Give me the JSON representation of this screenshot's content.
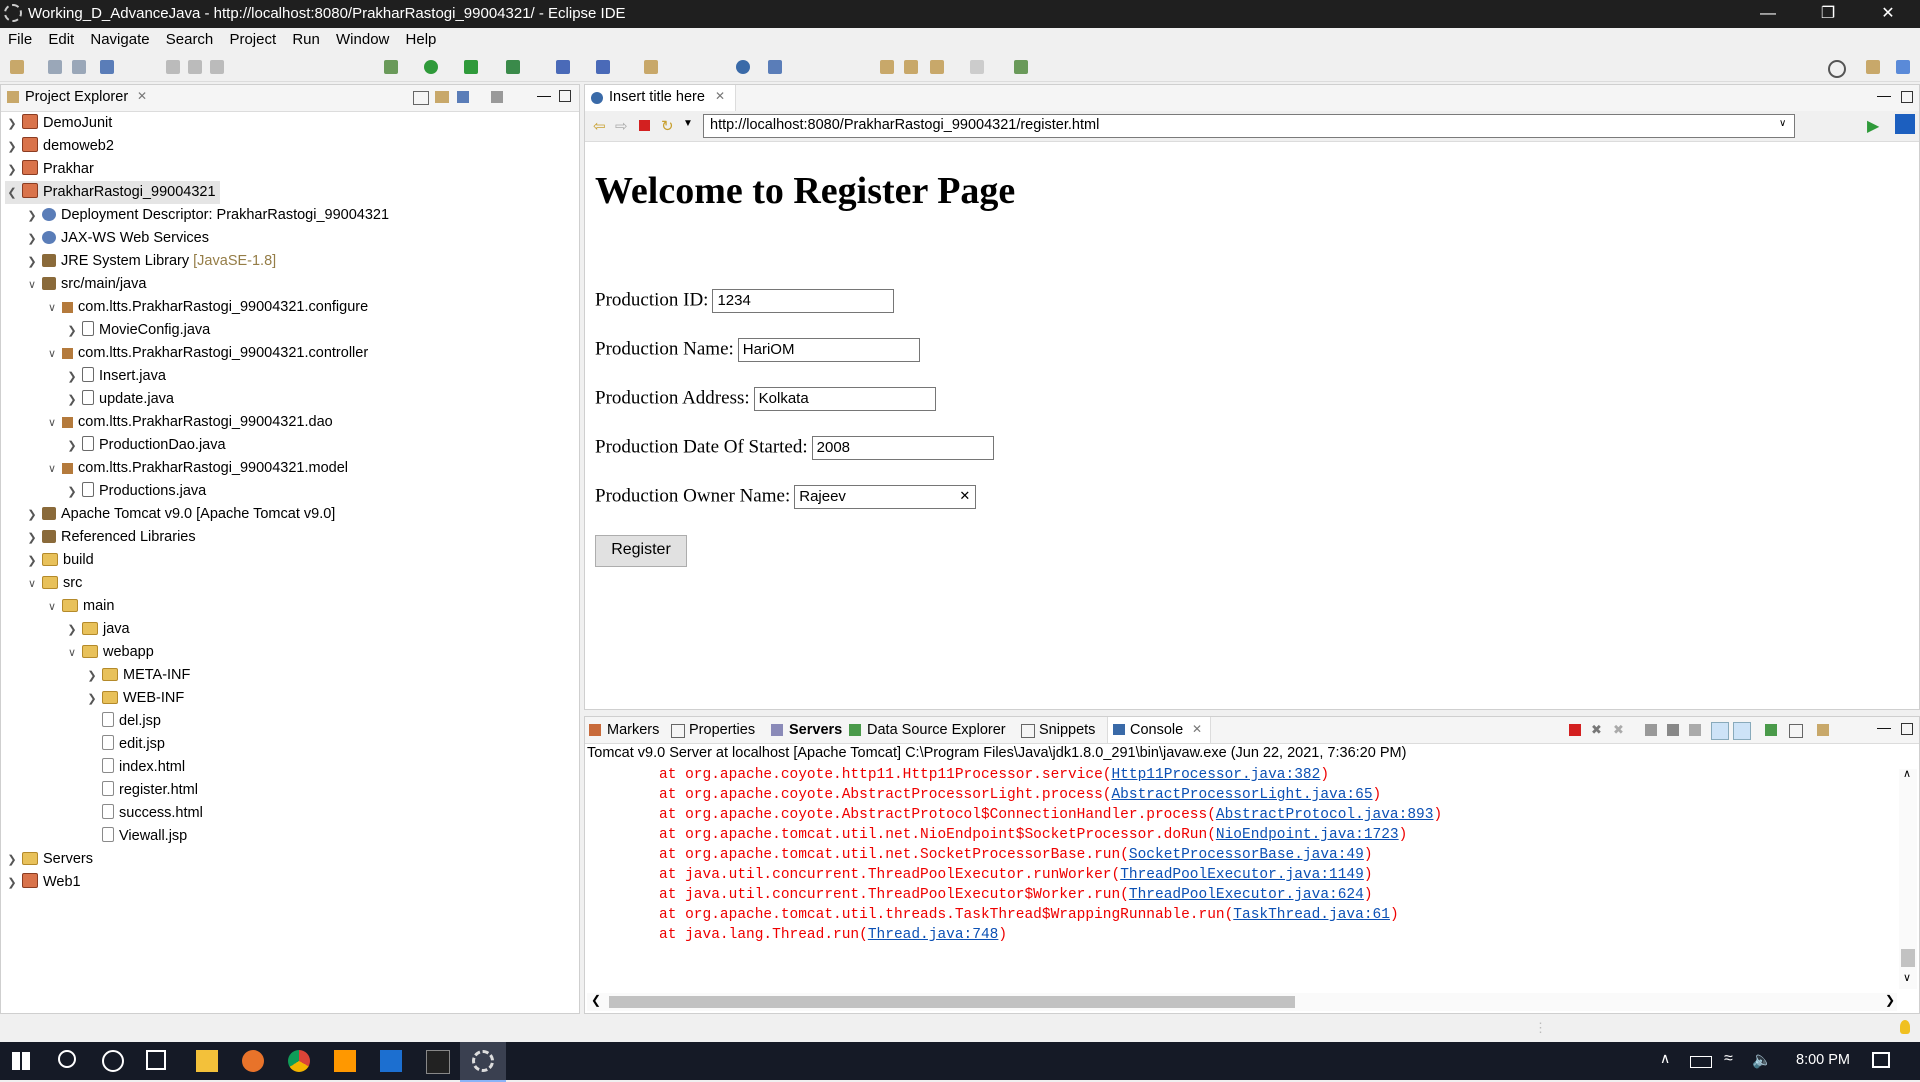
{
  "window": {
    "title": "Working_D_AdvanceJava - http://localhost:8080/PrakharRastogi_99004321/ - Eclipse IDE"
  },
  "menu": [
    "File",
    "Edit",
    "Navigate",
    "Search",
    "Project",
    "Run",
    "Window",
    "Help"
  ],
  "explorer": {
    "title": "Project Explorer",
    "items": [
      {
        "label": "DemoJunit",
        "decor": ""
      },
      {
        "label": "demoweb2",
        "decor": ""
      },
      {
        "label": "Prakhar",
        "decor": ""
      },
      {
        "label": "PrakharRastogi_99004321",
        "decor": ""
      },
      {
        "label": "Deployment Descriptor: PrakharRastogi_99004321",
        "decor": ""
      },
      {
        "label": "JAX-WS Web Services",
        "decor": ""
      },
      {
        "label": "JRE System Library",
        "decor": "[JavaSE-1.8]"
      },
      {
        "label": "src/main/java",
        "decor": ""
      },
      {
        "label": "com.ltts.PrakharRastogi_99004321.configure",
        "decor": ""
      },
      {
        "label": "MovieConfig.java",
        "decor": ""
      },
      {
        "label": "com.ltts.PrakharRastogi_99004321.controller",
        "decor": ""
      },
      {
        "label": "Insert.java",
        "decor": ""
      },
      {
        "label": "update.java",
        "decor": ""
      },
      {
        "label": "com.ltts.PrakharRastogi_99004321.dao",
        "decor": ""
      },
      {
        "label": "ProductionDao.java",
        "decor": ""
      },
      {
        "label": "com.ltts.PrakharRastogi_99004321.model",
        "decor": ""
      },
      {
        "label": "Productions.java",
        "decor": ""
      },
      {
        "label": "Apache Tomcat v9.0 [Apache Tomcat v9.0]",
        "decor": ""
      },
      {
        "label": "Referenced Libraries",
        "decor": ""
      },
      {
        "label": "build",
        "decor": ""
      },
      {
        "label": "src",
        "decor": ""
      },
      {
        "label": "main",
        "decor": ""
      },
      {
        "label": "java",
        "decor": ""
      },
      {
        "label": "webapp",
        "decor": ""
      },
      {
        "label": "META-INF",
        "decor": ""
      },
      {
        "label": "WEB-INF",
        "decor": ""
      },
      {
        "label": "del.jsp",
        "decor": ""
      },
      {
        "label": "edit.jsp",
        "decor": ""
      },
      {
        "label": "index.html",
        "decor": ""
      },
      {
        "label": "register.html",
        "decor": ""
      },
      {
        "label": "success.html",
        "decor": ""
      },
      {
        "label": "Viewall.jsp",
        "decor": ""
      },
      {
        "label": "Servers",
        "decor": ""
      },
      {
        "label": "Web1",
        "decor": ""
      }
    ]
  },
  "browser": {
    "tab_title": "Insert title here",
    "url": "http://localhost:8080/PrakharRastogi_99004321/register.html",
    "heading": "Welcome to Register Page",
    "fields": [
      {
        "label": "Production ID:",
        "value": "1234"
      },
      {
        "label": "Production Name:",
        "value": "HariOM"
      },
      {
        "label": "Production Address:",
        "value": "Kolkata"
      },
      {
        "label": "Production Date Of Started:",
        "value": "2008"
      },
      {
        "label": "Production Owner Name:",
        "value": "Rajeev"
      }
    ],
    "button": "Register"
  },
  "console": {
    "tabs": [
      "Markers",
      "Properties",
      "Servers",
      "Data Source Explorer",
      "Snippets",
      "Console"
    ],
    "description": "Tomcat v9.0 Server at localhost [Apache Tomcat] C:\\Program Files\\Java\\jdk1.8.0_291\\bin\\javaw.exe  (Jun 22, 2021, 7:36:20 PM)",
    "lines": [
      {
        "text": "at org.apache.coyote.http11.Http11Processor.service(",
        "link": "Http11Processor.java:382",
        "end": ")"
      },
      {
        "text": "at org.apache.coyote.AbstractProcessorLight.process(",
        "link": "AbstractProcessorLight.java:65",
        "end": ")"
      },
      {
        "text": "at org.apache.coyote.AbstractProtocol$ConnectionHandler.process(",
        "link": "AbstractProtocol.java:893",
        "end": ")"
      },
      {
        "text": "at org.apache.tomcat.util.net.NioEndpoint$SocketProcessor.doRun(",
        "link": "NioEndpoint.java:1723",
        "end": ")"
      },
      {
        "text": "at org.apache.tomcat.util.net.SocketProcessorBase.run(",
        "link": "SocketProcessorBase.java:49",
        "end": ")"
      },
      {
        "text": "at java.util.concurrent.ThreadPoolExecutor.runWorker(",
        "link": "ThreadPoolExecutor.java:1149",
        "end": ")"
      },
      {
        "text": "at java.util.concurrent.ThreadPoolExecutor$Worker.run(",
        "link": "ThreadPoolExecutor.java:624",
        "end": ")"
      },
      {
        "text": "at org.apache.tomcat.util.threads.TaskThread$WrappingRunnable.run(",
        "link": "TaskThread.java:61",
        "end": ")"
      },
      {
        "text": "at java.lang.Thread.run(",
        "link": "Thread.java:748",
        "end": ")"
      }
    ]
  },
  "taskbar": {
    "clock": "8:00 PM"
  }
}
